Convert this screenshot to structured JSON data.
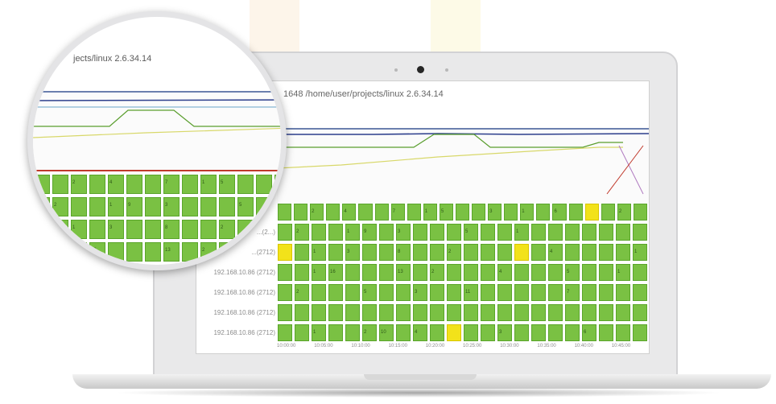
{
  "window": {
    "title": "1648  /home/user/projects/linux 2.6.34.14"
  },
  "zoom": {
    "title": "jects/linux 2.6.34.14"
  },
  "rows": [
    {
      "label": "",
      "bars": [
        [
          "b",
          ""
        ],
        [
          "b",
          ""
        ],
        [
          "b",
          "2"
        ],
        [
          "b",
          ""
        ],
        [
          "b",
          "4"
        ],
        [
          "b",
          ""
        ],
        [
          "b",
          ""
        ],
        [
          "b",
          "7"
        ],
        [
          "b",
          ""
        ],
        [
          "b",
          "1"
        ],
        [
          "b",
          "5"
        ],
        [
          "b",
          ""
        ],
        [
          "b",
          ""
        ],
        [
          "b",
          "3"
        ],
        [
          "b",
          ""
        ],
        [
          "b",
          "1"
        ],
        [
          "b",
          ""
        ],
        [
          "b",
          "6"
        ],
        [
          "b",
          ""
        ],
        [
          "y",
          ""
        ],
        [
          "b",
          ""
        ],
        [
          "b",
          "2"
        ],
        [
          "b",
          ""
        ]
      ]
    },
    {
      "label": "...(2...)",
      "bars": [
        [
          "b",
          ""
        ],
        [
          "b",
          "2"
        ],
        [
          "b",
          ""
        ],
        [
          "b",
          ""
        ],
        [
          "b",
          "1"
        ],
        [
          "b",
          "9"
        ],
        [
          "b",
          ""
        ],
        [
          "b",
          "3"
        ],
        [
          "b",
          ""
        ],
        [
          "b",
          ""
        ],
        [
          "b",
          ""
        ],
        [
          "b",
          "5"
        ],
        [
          "b",
          ""
        ],
        [
          "b",
          ""
        ],
        [
          "b",
          "1"
        ],
        [
          "b",
          ""
        ],
        [
          "b",
          ""
        ],
        [
          "b",
          ""
        ],
        [
          "b",
          ""
        ],
        [
          "b",
          ""
        ],
        [
          "b",
          ""
        ],
        [
          "b",
          ""
        ]
      ]
    },
    {
      "label": "...(2712)",
      "bars": [
        [
          "y",
          ""
        ],
        [
          "b",
          ""
        ],
        [
          "b",
          "1"
        ],
        [
          "b",
          ""
        ],
        [
          "b",
          "3"
        ],
        [
          "b",
          ""
        ],
        [
          "b",
          ""
        ],
        [
          "b",
          "8"
        ],
        [
          "b",
          ""
        ],
        [
          "b",
          ""
        ],
        [
          "b",
          "2"
        ],
        [
          "b",
          ""
        ],
        [
          "b",
          ""
        ],
        [
          "b",
          ""
        ],
        [
          "y",
          ""
        ],
        [
          "b",
          ""
        ],
        [
          "b",
          "4"
        ],
        [
          "b",
          ""
        ],
        [
          "b",
          ""
        ],
        [
          "b",
          ""
        ],
        [
          "b",
          ""
        ],
        [
          "b",
          "1"
        ]
      ]
    },
    {
      "label": "192.168.10.86 (2712)",
      "bars": [
        [
          "b",
          ""
        ],
        [
          "b",
          ""
        ],
        [
          "b",
          "1"
        ],
        [
          "b",
          "16"
        ],
        [
          "b",
          ""
        ],
        [
          "b",
          ""
        ],
        [
          "b",
          ""
        ],
        [
          "b",
          "13"
        ],
        [
          "b",
          ""
        ],
        [
          "b",
          "2"
        ],
        [
          "b",
          ""
        ],
        [
          "b",
          ""
        ],
        [
          "b",
          ""
        ],
        [
          "b",
          "4"
        ],
        [
          "b",
          ""
        ],
        [
          "b",
          ""
        ],
        [
          "b",
          ""
        ],
        [
          "b",
          "5"
        ],
        [
          "b",
          ""
        ],
        [
          "b",
          ""
        ],
        [
          "b",
          "1"
        ],
        [
          "b",
          ""
        ]
      ]
    },
    {
      "label": "192.168.10.86 (2712)",
      "bars": [
        [
          "b",
          ""
        ],
        [
          "b",
          "2"
        ],
        [
          "b",
          ""
        ],
        [
          "b",
          ""
        ],
        [
          "b",
          ""
        ],
        [
          "b",
          "5"
        ],
        [
          "b",
          ""
        ],
        [
          "b",
          ""
        ],
        [
          "b",
          "3"
        ],
        [
          "b",
          ""
        ],
        [
          "b",
          ""
        ],
        [
          "b",
          "11"
        ],
        [
          "b",
          ""
        ],
        [
          "b",
          ""
        ],
        [
          "b",
          ""
        ],
        [
          "b",
          ""
        ],
        [
          "b",
          ""
        ],
        [
          "b",
          "7"
        ],
        [
          "b",
          ""
        ],
        [
          "b",
          ""
        ],
        [
          "b",
          ""
        ],
        [
          "b",
          ""
        ]
      ]
    },
    {
      "label": "192.168.10.86 (2712)",
      "bars": [
        [
          "b",
          ""
        ],
        [
          "b",
          ""
        ],
        [
          "b",
          ""
        ],
        [
          "b",
          ""
        ],
        [
          "b",
          ""
        ],
        [
          "b",
          ""
        ],
        [
          "b",
          ""
        ],
        [
          "b",
          ""
        ],
        [
          "b",
          ""
        ],
        [
          "b",
          ""
        ],
        [
          "b",
          ""
        ],
        [
          "b",
          ""
        ],
        [
          "b",
          ""
        ],
        [
          "b",
          ""
        ],
        [
          "b",
          ""
        ],
        [
          "b",
          ""
        ],
        [
          "b",
          ""
        ],
        [
          "b",
          ""
        ],
        [
          "b",
          ""
        ],
        [
          "b",
          ""
        ],
        [
          "b",
          ""
        ],
        [
          "b",
          ""
        ]
      ]
    },
    {
      "label": "192.168.10.86 (2712)",
      "bars": [
        [
          "b",
          ""
        ],
        [
          "b",
          ""
        ],
        [
          "b",
          "1"
        ],
        [
          "b",
          ""
        ],
        [
          "b",
          ""
        ],
        [
          "b",
          "2"
        ],
        [
          "b",
          "10"
        ],
        [
          "b",
          ""
        ],
        [
          "b",
          "4"
        ],
        [
          "b",
          ""
        ],
        [
          "y",
          ""
        ],
        [
          "b",
          ""
        ],
        [
          "b",
          ""
        ],
        [
          "b",
          "3"
        ],
        [
          "b",
          ""
        ],
        [
          "b",
          ""
        ],
        [
          "b",
          ""
        ],
        [
          "b",
          ""
        ],
        [
          "b",
          "6"
        ],
        [
          "b",
          ""
        ],
        [
          "b",
          ""
        ],
        [
          "b",
          ""
        ]
      ]
    }
  ],
  "axis_ticks": [
    "10:00:00",
    "10:05:00",
    "10:10:00",
    "10:15:00",
    "10:20:00",
    "10:25:00",
    "10:30:00",
    "10:35:00",
    "10:40:00",
    "10:45:00"
  ],
  "colors": {
    "bar_normal": "#7ac143",
    "bar_highlight": "#f2e21a",
    "line_blue": "#2c3e8c",
    "line_green": "#5a9e2e",
    "line_yellow": "#d8d86a",
    "line_red": "#c0392b"
  },
  "icons": [
    "camera-icon"
  ]
}
